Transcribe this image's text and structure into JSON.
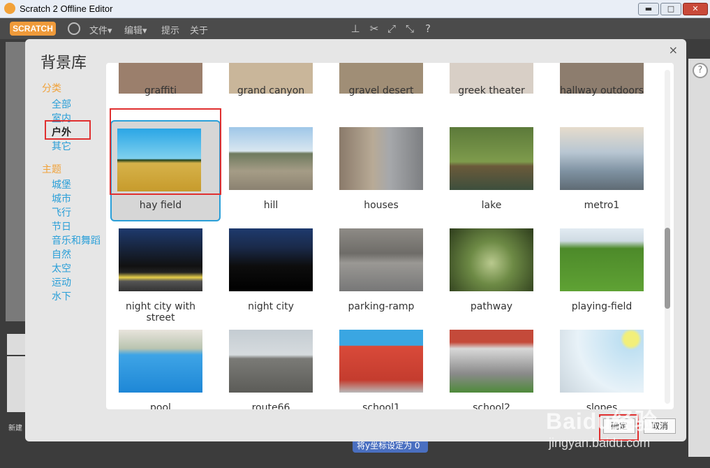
{
  "window": {
    "title": "Scratch 2 Offline Editor",
    "min": "▬",
    "max": "□",
    "close": "✕"
  },
  "menubar": {
    "logo": "SCRATCH",
    "items": [
      "文件▾",
      "编辑▾",
      "提示",
      "关于"
    ]
  },
  "dialog": {
    "title": "背景库",
    "close": "×",
    "category_heading": "分类",
    "categories": [
      "全部",
      "室内",
      "户外",
      "其它"
    ],
    "theme_heading": "主题",
    "themes": [
      "城堡",
      "城市",
      "飞行",
      "节日",
      "音乐和舞蹈",
      "自然",
      "太空",
      "运动",
      "水下"
    ],
    "selected_category": "户外",
    "ok_label": "确定",
    "cancel_label": "取消",
    "tiles": [
      {
        "label": "graffiti"
      },
      {
        "label": "grand canyon"
      },
      {
        "label": "gravel desert"
      },
      {
        "label": "greek theater"
      },
      {
        "label": "hallway outdoors"
      },
      {
        "label": "hay field",
        "selected": true
      },
      {
        "label": "hill"
      },
      {
        "label": "houses"
      },
      {
        "label": "lake"
      },
      {
        "label": "metro1"
      },
      {
        "label": "night city with street"
      },
      {
        "label": "night city"
      },
      {
        "label": "parking-ramp"
      },
      {
        "label": "pathway"
      },
      {
        "label": "playing-field"
      },
      {
        "label": "pool"
      },
      {
        "label": "route66"
      },
      {
        "label": "school1"
      },
      {
        "label": "school2"
      },
      {
        "label": "slopes"
      }
    ]
  },
  "footer": {
    "block_label": "将y坐标设定为 0",
    "left_label": "新建"
  },
  "help": "?",
  "watermark": {
    "brand": "Baidu经验",
    "url": "jingyan.baidu.com"
  },
  "colors": {
    "accent": "#2a9fd8",
    "orange": "#f0a23a",
    "highlight": "#e03030"
  }
}
